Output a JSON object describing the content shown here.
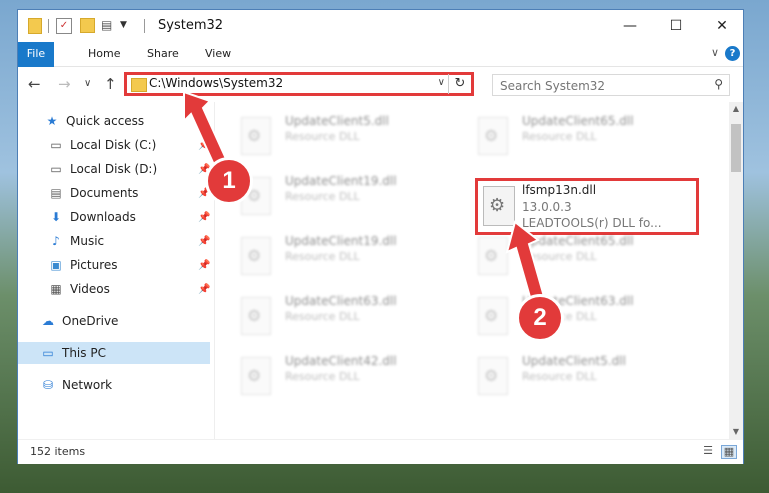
{
  "window": {
    "title": "System32",
    "controls": {
      "minimize": "—",
      "maximize": "☐",
      "close": "✕"
    }
  },
  "ribbon": {
    "tabs": [
      "File",
      "Home",
      "Share",
      "View"
    ],
    "help_label": "?",
    "collapse_label": "∨"
  },
  "addressbar": {
    "path": "C:\\Windows\\System32",
    "refresh_label": "↻",
    "dropdown_label": "∨",
    "search_placeholder": "Search System32"
  },
  "nav": {
    "back": "←",
    "forward": "→",
    "recent": "∨",
    "up": "↑"
  },
  "sidebar": {
    "items": [
      {
        "label": "Quick access",
        "icon": "star-icon",
        "glyph": "★"
      },
      {
        "label": "Local Disk (C:)",
        "icon": "drive-icon",
        "glyph": "▭",
        "pinned": true
      },
      {
        "label": "Local Disk (D:)",
        "icon": "drive-icon",
        "glyph": "▭",
        "pinned": true
      },
      {
        "label": "Documents",
        "icon": "documents-icon",
        "glyph": "▤",
        "pinned": true
      },
      {
        "label": "Downloads",
        "icon": "download-icon",
        "glyph": "⬇",
        "pinned": true
      },
      {
        "label": "Music",
        "icon": "music-icon",
        "glyph": "♪",
        "pinned": true
      },
      {
        "label": "Pictures",
        "icon": "pictures-icon",
        "glyph": "▣",
        "pinned": true
      },
      {
        "label": "Videos",
        "icon": "video-icon",
        "glyph": "▦",
        "pinned": true
      },
      {
        "label": "OneDrive",
        "icon": "cloud-icon",
        "glyph": "☁"
      },
      {
        "label": "This PC",
        "icon": "computer-icon",
        "glyph": "▭",
        "selected": true
      },
      {
        "label": "Network",
        "icon": "network-icon",
        "glyph": "⛁"
      }
    ]
  },
  "files": [
    {
      "name": "UpdateClient5.dll",
      "type": "Resource DLL"
    },
    {
      "name": "UpdateClient65.dll",
      "type": "Resource DLL"
    },
    {
      "name": "UpdateClient19.dll",
      "type": "Resource DLL"
    },
    {
      "name": "UpdateClient19.dll",
      "type": "Resource DLL"
    },
    {
      "name": "UpdateClient65.dll",
      "type": "Resource DLL"
    },
    {
      "name": "UpdateClient63.dll",
      "type": "Resource DLL"
    },
    {
      "name": "UpdateClient63.dll",
      "type": "Resource DLL"
    },
    {
      "name": "UpdateClient42.dll",
      "type": "Resource DLL"
    },
    {
      "name": "UpdateClient5.dll",
      "type": "Resource DLL"
    }
  ],
  "highlighted_file": {
    "name": "lfsmp13n.dll",
    "version": "13.0.0.3",
    "description": "LEADTOOLS(r) DLL fo..."
  },
  "status": {
    "item_count": "152 items"
  },
  "callouts": [
    "1",
    "2"
  ],
  "colors": {
    "accent": "#1979ca",
    "highlight_red": "#e23a3a",
    "selected_bg": "#cce4f7"
  }
}
